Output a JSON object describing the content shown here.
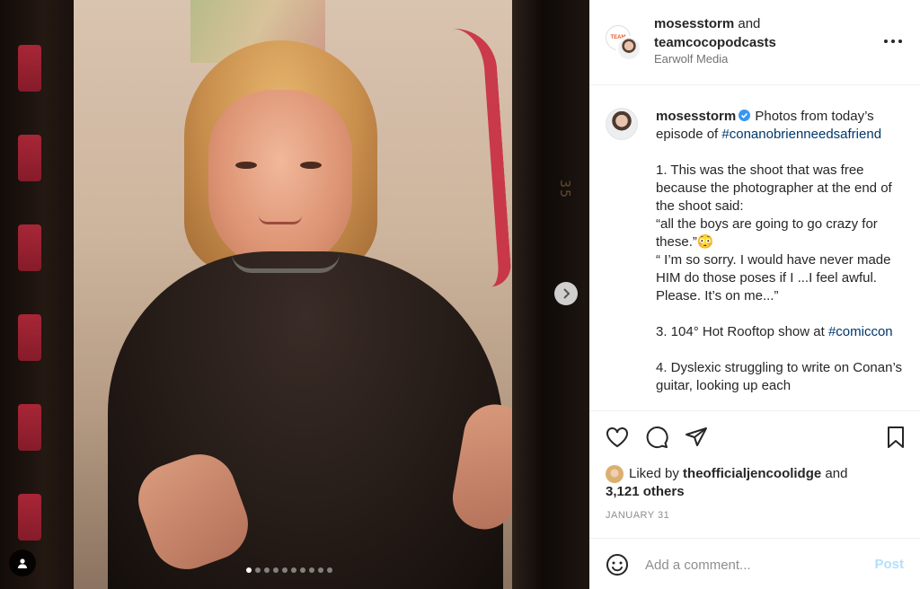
{
  "header": {
    "user1": "mosesstorm",
    "and": "and",
    "user2": "teamcocopodcasts",
    "subtitle": "Earwolf Media",
    "logo_text": "TEAM"
  },
  "caption": {
    "username": "mosesstorm",
    "intro": " Photos from today’s episode of ",
    "hashtag1": "#conanobrienneedsafriend",
    "body1": "\n\n1. This was the shoot that was free because the photographer at the end of the shoot said:\n“all the boys are going to go crazy for these.”😳\n“ I’m so sorry. I would have never made HIM do those poses if I ...I feel awful. Please. It’s on me...”\n\n3. 104° Hot Rooftop show at ",
    "hashtag2": "#comiccon",
    "body2": "\n\n4. Dyslexic struggling to write on Conan’s guitar, looking up each"
  },
  "likes": {
    "prefix": "Liked by ",
    "user": "theofficialjencoolidge",
    "and": " and",
    "others": "3,121 others"
  },
  "date": "JANUARY 31",
  "comment": {
    "placeholder": "Add a comment...",
    "post_label": "Post"
  },
  "carousel": {
    "total": 10,
    "active_index": 0
  },
  "film_numbers": "35",
  "colors": {
    "link": "#00376b",
    "verified": "#3897f0",
    "post_disabled": "#b2dffc",
    "muted": "#8e8e8e"
  },
  "icons": [
    "heart-icon",
    "comment-icon",
    "share-icon",
    "bookmark-icon",
    "more-icon",
    "chevron-right-icon",
    "user-tag-icon",
    "emoji-icon",
    "verified-icon"
  ]
}
